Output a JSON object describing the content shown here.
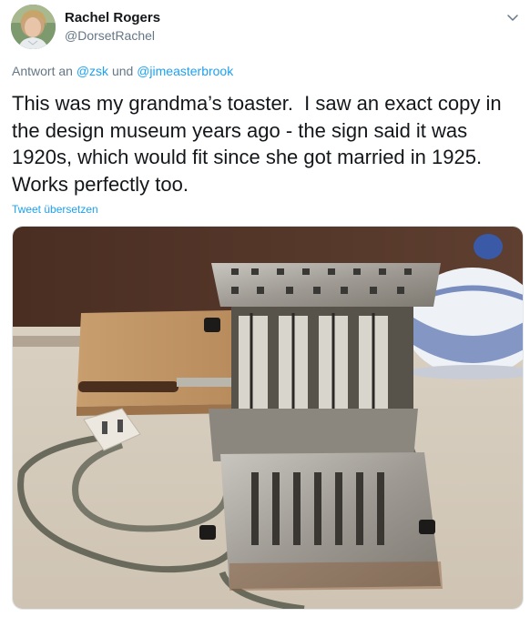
{
  "author": {
    "name": "Rachel Rogers",
    "handle": "@DorsetRachel"
  },
  "reply": {
    "prefix": "Antwort an",
    "user1": "@zsk",
    "conjunction": "und",
    "user2": "@jimeasterbrook"
  },
  "tweet": {
    "text": "This was my grandma’s toaster.  I saw an exact copy in the design museum years ago - the sign said it was 1920s, which would fit since she got married in 1925. Works perfectly too."
  },
  "translate_label": "Tweet übersetzen",
  "colors": {
    "link": "#1da1f2",
    "secondary_text": "#657786",
    "primary_text": "#14171a"
  },
  "icons": {
    "menu": "chevron-down-icon"
  }
}
